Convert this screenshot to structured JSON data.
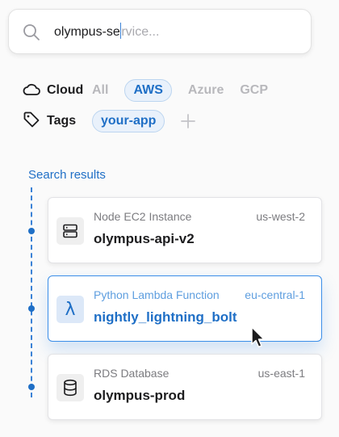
{
  "search": {
    "typed": "olympus-se",
    "placeholder_rest": "rvice...",
    "icon": "search-icon"
  },
  "filters": {
    "cloud": {
      "label": "Cloud",
      "icon": "cloud-icon",
      "options": [
        "All",
        "AWS",
        "Azure",
        "GCP"
      ],
      "selected": "AWS"
    },
    "tags": {
      "label": "Tags",
      "icon": "tag-icon",
      "items": [
        "your-app"
      ],
      "add_icon": "plus-icon"
    }
  },
  "results": {
    "title": "Search results",
    "items": [
      {
        "type": "Node EC2 Instance",
        "region": "us-west-2",
        "name": "olympus-api-v2",
        "icon": "server-icon",
        "selected": false
      },
      {
        "type": "Python Lambda Function",
        "region": "eu-central-1",
        "name": "nightly_lightning_bolt",
        "icon": "lambda-icon",
        "selected": true
      },
      {
        "type": "RDS Database",
        "region": "us-east-1",
        "name": "olympus-prod",
        "icon": "database-icon",
        "selected": false
      }
    ]
  },
  "colors": {
    "accent": "#1f6fc6",
    "accent_light": "#e9f1fb",
    "muted": "#b8b8bc"
  }
}
